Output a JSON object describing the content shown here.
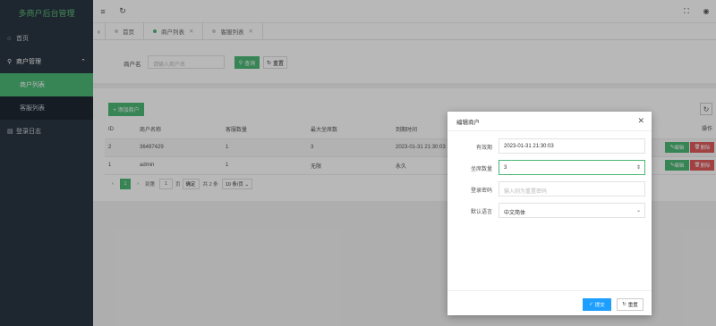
{
  "sidebar": {
    "title": "多商户后台管理",
    "home": "首页",
    "merchant_mgmt": "商户管理",
    "sub_items": [
      "商户列表",
      "客服列表"
    ],
    "login_log": "登录日志"
  },
  "tabs": [
    {
      "label": "首页",
      "closable": false
    },
    {
      "label": "商户列表",
      "closable": true,
      "active": true
    },
    {
      "label": "客服列表",
      "closable": true
    }
  ],
  "search": {
    "label": "商户名",
    "placeholder": "请输入商户名",
    "query_btn": "查询",
    "reset_btn": "重置"
  },
  "list": {
    "add_btn": "+ 添加商户",
    "columns": [
      "ID",
      "商户名称",
      "客服数量",
      "最大坐席数",
      "到期时间"
    ],
    "ops_header": "操作",
    "rows": [
      [
        "2",
        "36497429",
        "1",
        "3",
        "2023-01-31 21:30:03"
      ],
      [
        "1",
        "admin",
        "1",
        "无限",
        "永久"
      ]
    ],
    "edit_label": "编辑",
    "delete_label": "删除"
  },
  "pager": {
    "current_page": "1",
    "goto_label": "到第",
    "goto_value": "1",
    "page_unit": "页",
    "ok_label": "确定",
    "total": "共 2 条",
    "page_size": "10 条/页"
  },
  "modal": {
    "title": "编辑商户",
    "fields": [
      {
        "label": "有效期",
        "value": "2023-01-31 21:30:03",
        "placeholder": ""
      },
      {
        "label": "坐席数量",
        "value": "3",
        "placeholder": ""
      },
      {
        "label": "登录密码",
        "value": "",
        "placeholder": "输入则为重置密码"
      },
      {
        "label": "默认语言",
        "value": "中文简体",
        "placeholder": ""
      }
    ],
    "submit_btn": "提交",
    "reset_btn": "重置"
  },
  "colors": {
    "accent": "#4db776",
    "sidebar_bg": "#2a3542",
    "danger": "#e05b5b",
    "primary_blue": "#1e9fff"
  }
}
